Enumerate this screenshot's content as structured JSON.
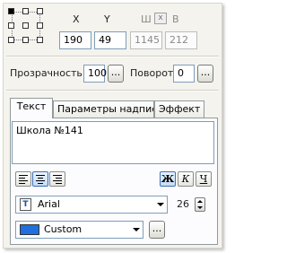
{
  "position": {
    "x_label": "X",
    "y_label": "Y",
    "x_value": "190",
    "y_value": "49",
    "w_label": "Ш",
    "h_label": "В",
    "w_value": "1145",
    "h_value": "212",
    "link_glyph": "x"
  },
  "opacity": {
    "label": "Прозрачность",
    "value": "100",
    "button": "..."
  },
  "rotation": {
    "label": "Поворот",
    "value": "0",
    "button": "..."
  },
  "tabs": [
    {
      "label": "Текст",
      "active": true
    },
    {
      "label": "Параметры надписи",
      "active": false
    },
    {
      "label": "Эффект",
      "active": false
    }
  ],
  "text": {
    "value": "Школа №141"
  },
  "format": {
    "bold": "Ж",
    "italic": "К",
    "underline": "Ч"
  },
  "font": {
    "name": "Arial",
    "size": "26",
    "icon": "font-file-icon"
  },
  "color": {
    "name": "Custom",
    "swatch": "#1f6fe0",
    "button": "..."
  }
}
